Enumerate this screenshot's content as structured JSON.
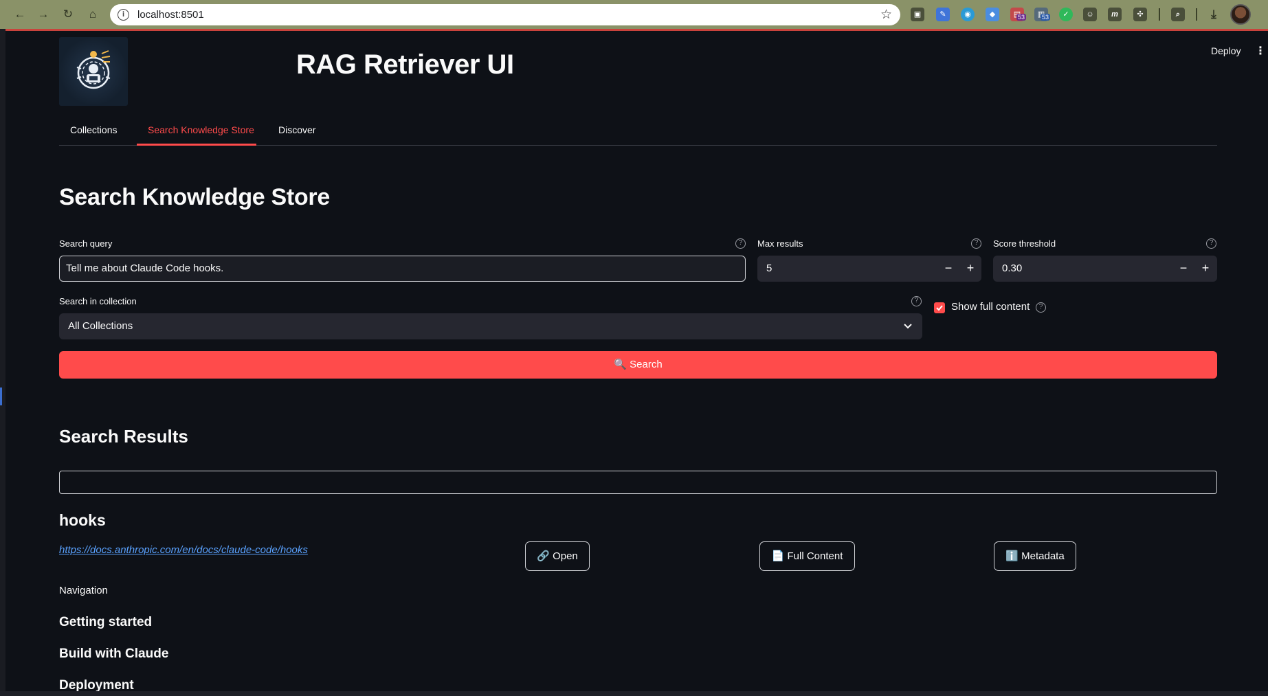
{
  "browser": {
    "url": "localhost:8501",
    "extension_badges": [
      "53",
      "53"
    ]
  },
  "app": {
    "title": "RAG Retriever UI",
    "deploy_label": "Deploy",
    "menu_icon": "⋮"
  },
  "tabs": [
    {
      "label": "Collections",
      "active": false
    },
    {
      "label": "Search Knowledge Store",
      "active": true
    },
    {
      "label": "Discover",
      "active": false
    }
  ],
  "search_page": {
    "heading": "Search Knowledge Store",
    "query_label": "Search query",
    "query_value": "Tell me about Claude Code hooks.",
    "max_results_label": "Max results",
    "max_results_value": "5",
    "score_threshold_label": "Score threshold",
    "score_threshold_value": "0.30",
    "collection_label": "Search in collection",
    "collection_value": "All Collections",
    "show_full_content_label": "Show full content",
    "show_full_content_checked": true,
    "search_button_label": "🔍 Search"
  },
  "results": {
    "heading": "Search Results",
    "items": [
      {
        "title": "hooks",
        "url": "https://docs.anthropic.com/en/docs/claude-code/hooks",
        "open_label": "🔗 Open",
        "full_content_label": "📄 Full Content",
        "metadata_label": "ℹ️ Metadata",
        "content_lines": [
          "Navigation"
        ],
        "content_sections": [
          "Getting started",
          "Build with Claude",
          "Deployment"
        ]
      }
    ]
  },
  "colors": {
    "background": "#0e1117",
    "accent": "#ff4b4b",
    "input_bg": "#262730",
    "link": "#5aa2ff"
  }
}
